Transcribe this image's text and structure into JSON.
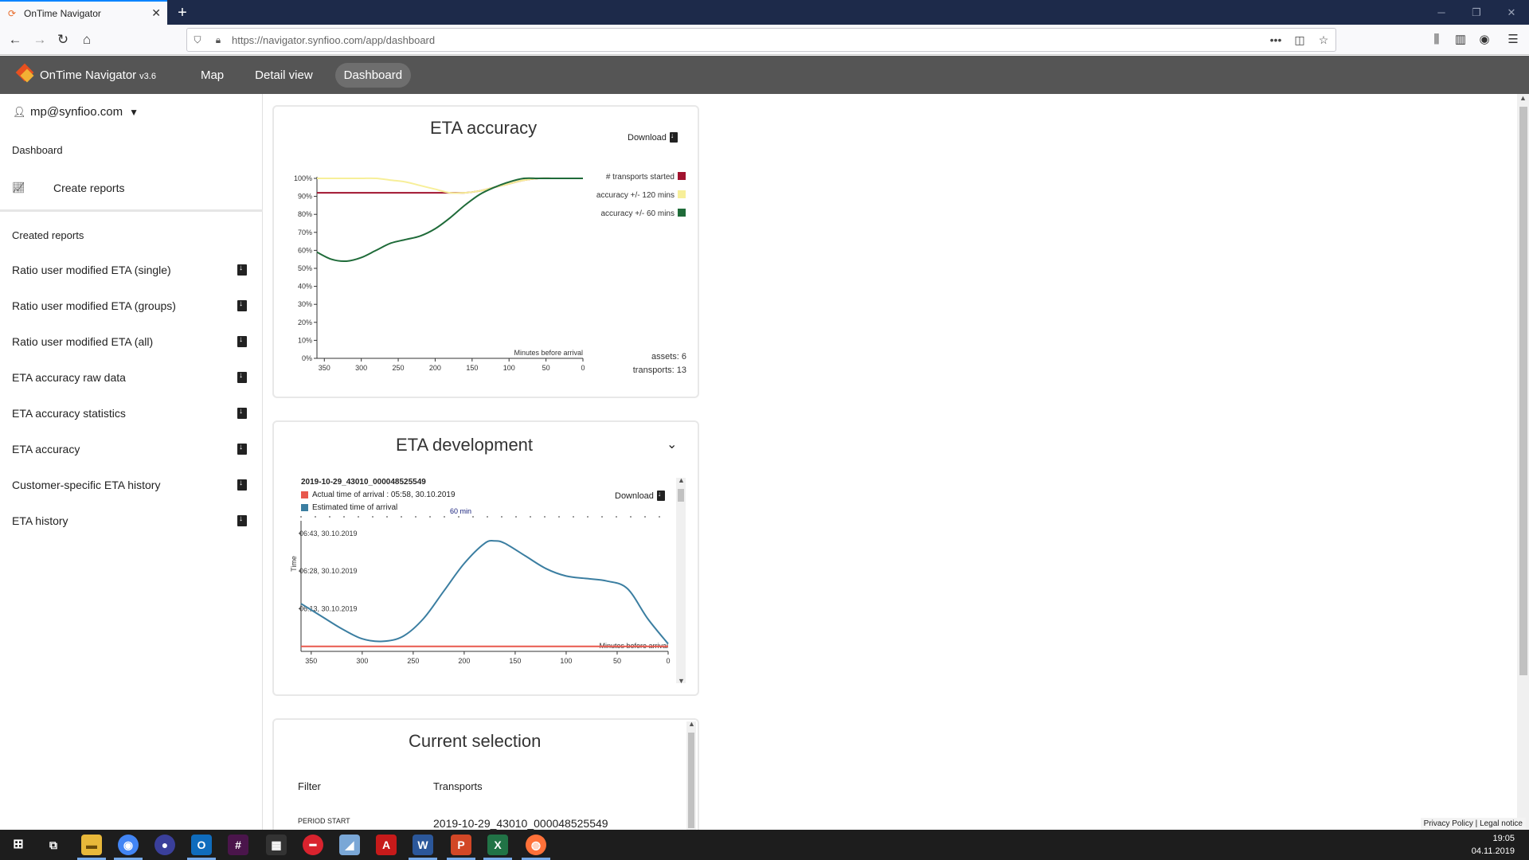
{
  "browser": {
    "tab_title": "OnTime Navigator",
    "url": "https://navigator.synfioo.com/app/dashboard"
  },
  "app": {
    "title": "OnTime Navigator",
    "version": "v3.6",
    "nav": [
      "Map",
      "Detail view",
      "Dashboard"
    ],
    "active_nav": "Dashboard"
  },
  "sidebar": {
    "user": "mp@synfioo.com",
    "dashboard_label": "Dashboard",
    "create_reports": "Create reports",
    "created_reports_heading": "Created reports",
    "reports": [
      "Ratio user modified ETA (single)",
      "Ratio user modified ETA (groups)",
      "Ratio user modified ETA (all)",
      "ETA accuracy raw data",
      "ETA accuracy statistics",
      "ETA accuracy",
      "Customer-specific ETA history",
      "ETA history"
    ]
  },
  "eta_accuracy": {
    "title": "ETA accuracy",
    "download": "Download",
    "assets": "assets: 6",
    "transports": "transports: 13"
  },
  "eta_development": {
    "title": "ETA development",
    "download": "Download",
    "transport_id": "2019-10-29_43010_000048525549",
    "actual_label": "Actual time of arrival : 05:58, 30.10.2019",
    "estimated_label": "Estimated time of arrival",
    "interval_label": "60 min"
  },
  "current_selection": {
    "title": "Current selection",
    "filter_label": "Filter",
    "transports_label": "Transports",
    "period_start_label": "PERIOD START",
    "transport_value": "2019-10-29_43010_000048525549"
  },
  "footer": {
    "links": "Privacy Policy | Legal notice"
  },
  "taskbar": {
    "time": "19:05",
    "date": "04.11.2019"
  },
  "chart_data": [
    {
      "type": "line",
      "title": "ETA accuracy",
      "xlabel": "Minutes before arrival",
      "ylabel": "",
      "x": [
        360,
        340,
        320,
        300,
        280,
        260,
        240,
        220,
        200,
        180,
        160,
        140,
        120,
        100,
        80,
        60,
        40,
        20,
        0
      ],
      "xlim": [
        360,
        0
      ],
      "ylim": [
        0,
        100
      ],
      "x_ticks": [
        "350",
        "300",
        "250",
        "200",
        "150",
        "100",
        "50",
        "0"
      ],
      "y_ticks": [
        "0%",
        "10%",
        "20%",
        "30%",
        "40%",
        "50%",
        "60%",
        "70%",
        "80%",
        "90%",
        "100%"
      ],
      "series": [
        {
          "name": "# transports started",
          "color": "#a1132f",
          "values": [
            92,
            92,
            92,
            92,
            92,
            92,
            92,
            92,
            92,
            92,
            92,
            93,
            95,
            97,
            99,
            100,
            100,
            100,
            100
          ]
        },
        {
          "name": "accuracy +/- 120 mins",
          "color": "#f7ef99",
          "values": [
            100,
            100,
            100,
            100,
            100,
            99,
            98,
            96,
            94,
            92,
            92,
            93,
            95,
            97,
            99,
            100,
            100,
            100,
            100
          ]
        },
        {
          "name": "accuracy +/- 60 mins",
          "color": "#1f6b39",
          "values": [
            59,
            55,
            54,
            56,
            60,
            64,
            66,
            68,
            72,
            78,
            85,
            91,
            95,
            98,
            100,
            100,
            100,
            100,
            100
          ]
        }
      ],
      "legend": "top-right"
    },
    {
      "type": "line",
      "title": "2019-10-29_43010_000048525549",
      "xlabel": "Minutes before arrival",
      "ylabel": "Time",
      "x": [
        360,
        340,
        320,
        300,
        280,
        260,
        240,
        220,
        200,
        180,
        170,
        160,
        140,
        120,
        100,
        80,
        60,
        40,
        20,
        0
      ],
      "xlim": [
        360,
        0
      ],
      "x_ticks": [
        "350",
        "300",
        "250",
        "200",
        "150",
        "100",
        "50",
        "0"
      ],
      "y_ticks": [
        "06:13, 30.10.2019",
        "06:28, 30.10.2019",
        "06:43, 30.10.2019"
      ],
      "series": [
        {
          "name": "Estimated time of arrival",
          "color": "#3b7ea1",
          "values": [
            "06:15",
            "06:10",
            "06:05",
            "06:01",
            "06:00",
            "06:02",
            "06:09",
            "06:20",
            "06:31",
            "06:39",
            "06:40",
            "06:39",
            "06:34",
            "06:29",
            "06:26",
            "06:25",
            "06:24",
            "06:21",
            "06:09",
            "05:59"
          ]
        },
        {
          "name": "Actual time of arrival",
          "color": "#e8584d",
          "values": [
            "05:58",
            "05:58",
            "05:58",
            "05:58",
            "05:58",
            "05:58",
            "05:58",
            "05:58",
            "05:58",
            "05:58",
            "05:58",
            "05:58",
            "05:58",
            "05:58",
            "05:58",
            "05:58",
            "05:58",
            "05:58",
            "05:58",
            "05:58"
          ]
        }
      ]
    }
  ]
}
